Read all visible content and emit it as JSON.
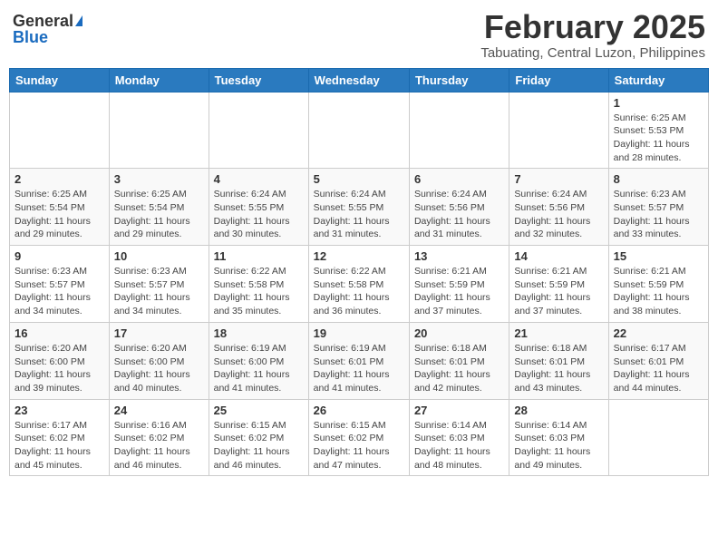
{
  "header": {
    "logo_general": "General",
    "logo_blue": "Blue",
    "month": "February 2025",
    "location": "Tabuating, Central Luzon, Philippines"
  },
  "weekdays": [
    "Sunday",
    "Monday",
    "Tuesday",
    "Wednesday",
    "Thursday",
    "Friday",
    "Saturday"
  ],
  "weeks": [
    [
      {
        "day": "",
        "info": ""
      },
      {
        "day": "",
        "info": ""
      },
      {
        "day": "",
        "info": ""
      },
      {
        "day": "",
        "info": ""
      },
      {
        "day": "",
        "info": ""
      },
      {
        "day": "",
        "info": ""
      },
      {
        "day": "1",
        "info": "Sunrise: 6:25 AM\nSunset: 5:53 PM\nDaylight: 11 hours and 28 minutes."
      }
    ],
    [
      {
        "day": "2",
        "info": "Sunrise: 6:25 AM\nSunset: 5:54 PM\nDaylight: 11 hours and 29 minutes."
      },
      {
        "day": "3",
        "info": "Sunrise: 6:25 AM\nSunset: 5:54 PM\nDaylight: 11 hours and 29 minutes."
      },
      {
        "day": "4",
        "info": "Sunrise: 6:24 AM\nSunset: 5:55 PM\nDaylight: 11 hours and 30 minutes."
      },
      {
        "day": "5",
        "info": "Sunrise: 6:24 AM\nSunset: 5:55 PM\nDaylight: 11 hours and 31 minutes."
      },
      {
        "day": "6",
        "info": "Sunrise: 6:24 AM\nSunset: 5:56 PM\nDaylight: 11 hours and 31 minutes."
      },
      {
        "day": "7",
        "info": "Sunrise: 6:24 AM\nSunset: 5:56 PM\nDaylight: 11 hours and 32 minutes."
      },
      {
        "day": "8",
        "info": "Sunrise: 6:23 AM\nSunset: 5:57 PM\nDaylight: 11 hours and 33 minutes."
      }
    ],
    [
      {
        "day": "9",
        "info": "Sunrise: 6:23 AM\nSunset: 5:57 PM\nDaylight: 11 hours and 34 minutes."
      },
      {
        "day": "10",
        "info": "Sunrise: 6:23 AM\nSunset: 5:57 PM\nDaylight: 11 hours and 34 minutes."
      },
      {
        "day": "11",
        "info": "Sunrise: 6:22 AM\nSunset: 5:58 PM\nDaylight: 11 hours and 35 minutes."
      },
      {
        "day": "12",
        "info": "Sunrise: 6:22 AM\nSunset: 5:58 PM\nDaylight: 11 hours and 36 minutes."
      },
      {
        "day": "13",
        "info": "Sunrise: 6:21 AM\nSunset: 5:59 PM\nDaylight: 11 hours and 37 minutes."
      },
      {
        "day": "14",
        "info": "Sunrise: 6:21 AM\nSunset: 5:59 PM\nDaylight: 11 hours and 37 minutes."
      },
      {
        "day": "15",
        "info": "Sunrise: 6:21 AM\nSunset: 5:59 PM\nDaylight: 11 hours and 38 minutes."
      }
    ],
    [
      {
        "day": "16",
        "info": "Sunrise: 6:20 AM\nSunset: 6:00 PM\nDaylight: 11 hours and 39 minutes."
      },
      {
        "day": "17",
        "info": "Sunrise: 6:20 AM\nSunset: 6:00 PM\nDaylight: 11 hours and 40 minutes."
      },
      {
        "day": "18",
        "info": "Sunrise: 6:19 AM\nSunset: 6:00 PM\nDaylight: 11 hours and 41 minutes."
      },
      {
        "day": "19",
        "info": "Sunrise: 6:19 AM\nSunset: 6:01 PM\nDaylight: 11 hours and 41 minutes."
      },
      {
        "day": "20",
        "info": "Sunrise: 6:18 AM\nSunset: 6:01 PM\nDaylight: 11 hours and 42 minutes."
      },
      {
        "day": "21",
        "info": "Sunrise: 6:18 AM\nSunset: 6:01 PM\nDaylight: 11 hours and 43 minutes."
      },
      {
        "day": "22",
        "info": "Sunrise: 6:17 AM\nSunset: 6:01 PM\nDaylight: 11 hours and 44 minutes."
      }
    ],
    [
      {
        "day": "23",
        "info": "Sunrise: 6:17 AM\nSunset: 6:02 PM\nDaylight: 11 hours and 45 minutes."
      },
      {
        "day": "24",
        "info": "Sunrise: 6:16 AM\nSunset: 6:02 PM\nDaylight: 11 hours and 46 minutes."
      },
      {
        "day": "25",
        "info": "Sunrise: 6:15 AM\nSunset: 6:02 PM\nDaylight: 11 hours and 46 minutes."
      },
      {
        "day": "26",
        "info": "Sunrise: 6:15 AM\nSunset: 6:02 PM\nDaylight: 11 hours and 47 minutes."
      },
      {
        "day": "27",
        "info": "Sunrise: 6:14 AM\nSunset: 6:03 PM\nDaylight: 11 hours and 48 minutes."
      },
      {
        "day": "28",
        "info": "Sunrise: 6:14 AM\nSunset: 6:03 PM\nDaylight: 11 hours and 49 minutes."
      },
      {
        "day": "",
        "info": ""
      }
    ]
  ]
}
